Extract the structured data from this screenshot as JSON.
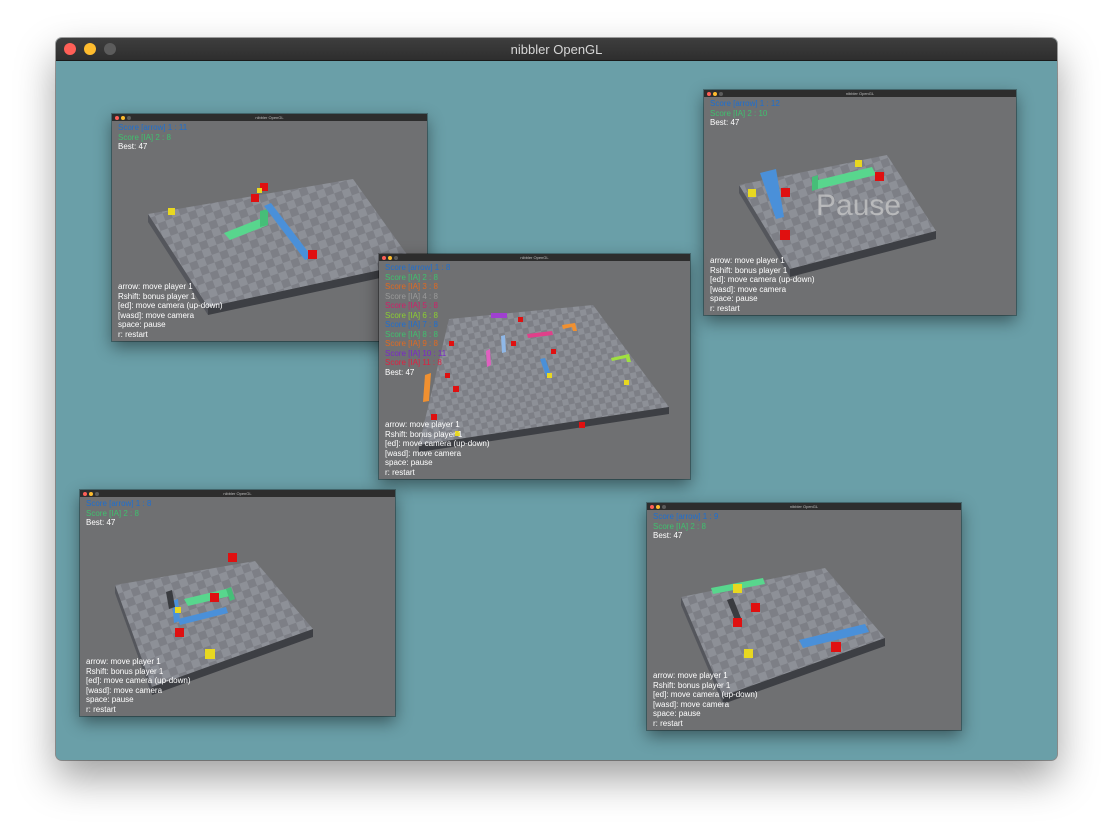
{
  "window": {
    "title": "nibbler OpenGL"
  },
  "subwindow_title": "nibbler OpenGL",
  "colors": {
    "background": "#6a9fa8",
    "score_player": "#1e6fd0",
    "score_player2": "#3fc06e",
    "best": "#ffffff",
    "snake_blue": "#4a90d9",
    "snake_green": "#58d68d",
    "food_red": "#e01010",
    "bonus_yellow": "#e8d820"
  },
  "help_lines": [
    "arrow: move player 1",
    "Rshift: bonus player 1",
    "[ed]: move camera (up-down)",
    "[wasd]: move camera",
    "space: pause",
    "r: restart"
  ],
  "windows": {
    "top_left": {
      "scores": [
        {
          "text": "Score [arrow] 1 : 11",
          "color": "#1e6fd0"
        },
        {
          "text": "Score [IA] 2 : 8",
          "color": "#3fc06e"
        }
      ],
      "best": "Best: 47"
    },
    "top_right": {
      "scores": [
        {
          "text": "Score [arrow] 1 : 12",
          "color": "#1e6fd0"
        },
        {
          "text": "Score [IA] 2 : 10",
          "color": "#3fc06e"
        }
      ],
      "best": "Best: 47",
      "overlay": "Pause"
    },
    "center": {
      "scores": [
        {
          "text": "Score [arrow] 1 : 8",
          "color": "#1e6fd0"
        },
        {
          "text": "Score [IA] 2 : 8",
          "color": "#3fc06e"
        },
        {
          "text": "Score [IA] 3 : 8",
          "color": "#e06a20"
        },
        {
          "text": "Score [IA] 4 : 8",
          "color": "#9a9a9a"
        },
        {
          "text": "Score [IA] 5 : 8",
          "color": "#d0206a"
        },
        {
          "text": "Score [IA] 6 : 8",
          "color": "#8ad030"
        },
        {
          "text": "Score [IA] 7 : 8",
          "color": "#1e6fd0"
        },
        {
          "text": "Score [IA] 8 : 8",
          "color": "#3fc06e"
        },
        {
          "text": "Score [IA] 9 : 8",
          "color": "#e06a20"
        },
        {
          "text": "Score [IA] 10 : 11",
          "color": "#7a28c8"
        },
        {
          "text": "Score [IA] 11 : 8",
          "color": "#e02040"
        }
      ],
      "best": "Best: 47"
    },
    "bottom_left": {
      "scores": [
        {
          "text": "Score [arrow] 1 : 8",
          "color": "#1e6fd0"
        },
        {
          "text": "Score [IA] 2 : 8",
          "color": "#3fc06e"
        }
      ],
      "best": "Best: 47"
    },
    "bottom_right": {
      "scores": [
        {
          "text": "Score [arrow] 1 : 9",
          "color": "#1e6fd0"
        },
        {
          "text": "Score [IA] 2 : 8",
          "color": "#3fc06e"
        }
      ],
      "best": "Best: 47"
    }
  }
}
